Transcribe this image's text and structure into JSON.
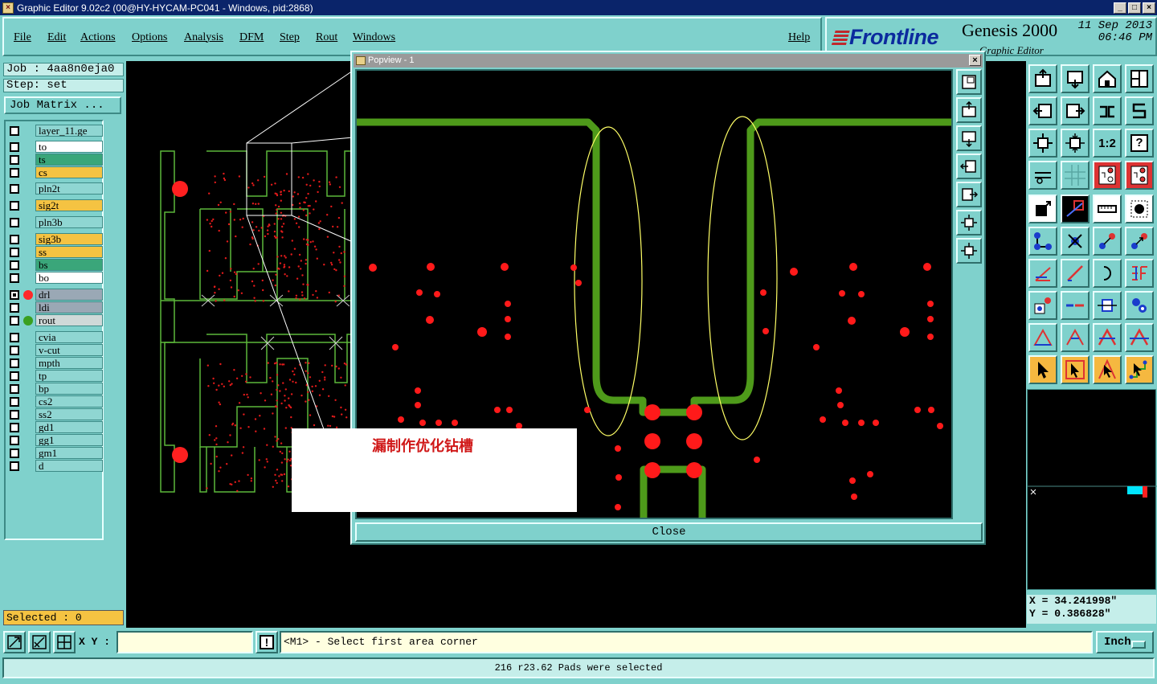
{
  "window": {
    "title": "Graphic Editor 9.02c2 (00@HY-HYCAM-PC041 - Windows, pid:2868)",
    "min_label": "_",
    "max_label": "□",
    "close_label": "×"
  },
  "menu": {
    "file": "File",
    "edit": "Edit",
    "actions": "Actions",
    "options": "Options",
    "analysis": "Analysis",
    "dfm": "DFM",
    "step": "Step",
    "rout": "Rout",
    "windows": "Windows",
    "help": "Help"
  },
  "brand": {
    "logo": "Frontline",
    "product": "Genesis 2000",
    "subtitle": "Graphic Editor",
    "date": "11 Sep 2013",
    "time": "06:46 PM"
  },
  "job": {
    "job_label": "Job : 4aa8n0eja0",
    "step_label": "Step: set",
    "matrix_button": "Job Matrix ..."
  },
  "layers": [
    {
      "name": "layer_11.ge",
      "color": "#8fd6d2",
      "checked": false
    },
    {
      "name": "to",
      "color": "#ffffff",
      "checked": false
    },
    {
      "name": "ts",
      "color": "#3aa67a",
      "checked": false
    },
    {
      "name": "cs",
      "color": "#f5c342",
      "checked": false
    },
    {
      "name": "pln2t",
      "color": "#8fd6d2",
      "checked": false
    },
    {
      "name": "sig2t",
      "color": "#f5c342",
      "checked": false
    },
    {
      "name": "pln3b",
      "color": "#8fd6d2",
      "checked": false
    },
    {
      "name": "sig3b",
      "color": "#f5c342",
      "checked": false
    },
    {
      "name": "ss",
      "color": "#f5c342",
      "checked": false
    },
    {
      "name": "bs",
      "color": "#3aa67a",
      "checked": false
    },
    {
      "name": "bo",
      "color": "#ffffff",
      "checked": false
    },
    {
      "name": "drl",
      "color": "#9aa8b5",
      "checked": true,
      "dot": "#ff2a2a"
    },
    {
      "name": "ldi",
      "color": "#9aa8b5",
      "checked": false
    },
    {
      "name": "rout",
      "color": "#cfd9d8",
      "checked": false,
      "dot": "#3aa020"
    },
    {
      "name": "cvia",
      "color": "#8fd6d2",
      "checked": false
    },
    {
      "name": "v-cut",
      "color": "#8fd6d2",
      "checked": false
    },
    {
      "name": "mpth",
      "color": "#8fd6d2",
      "checked": false
    },
    {
      "name": "tp",
      "color": "#8fd6d2",
      "checked": false
    },
    {
      "name": "bp",
      "color": "#8fd6d2",
      "checked": false
    },
    {
      "name": "cs2",
      "color": "#8fd6d2",
      "checked": false
    },
    {
      "name": "ss2",
      "color": "#8fd6d2",
      "checked": false
    },
    {
      "name": "gd1",
      "color": "#8fd6d2",
      "checked": false
    },
    {
      "name": "gg1",
      "color": "#8fd6d2",
      "checked": false
    },
    {
      "name": "gm1",
      "color": "#8fd6d2",
      "checked": false
    },
    {
      "name": "d",
      "color": "#8fd6d2",
      "checked": false
    }
  ],
  "selected": "Selected : 0",
  "popview": {
    "title": "Popview - 1",
    "close_button": "Close"
  },
  "annotation": {
    "text": "漏制作优化钻槽"
  },
  "tools": {
    "ratio_label": "1:2",
    "help_label": "?",
    "f_label": "F"
  },
  "coords": {
    "x": "X = 34.241998\"",
    "y": "Y = 0.386828\""
  },
  "command": {
    "xy_label": "X Y :",
    "xy_value": "",
    "alert_label": "!",
    "prompt": "<M1> - Select first area corner",
    "units": "Inch"
  },
  "status": "216 r23.62 Pads were selected",
  "colors": {
    "teal": "#7fd1cc",
    "trace": "#4e9a1a",
    "pad": "#ff1a1a",
    "outline": "#5cb83a",
    "annot": "#d01818"
  }
}
